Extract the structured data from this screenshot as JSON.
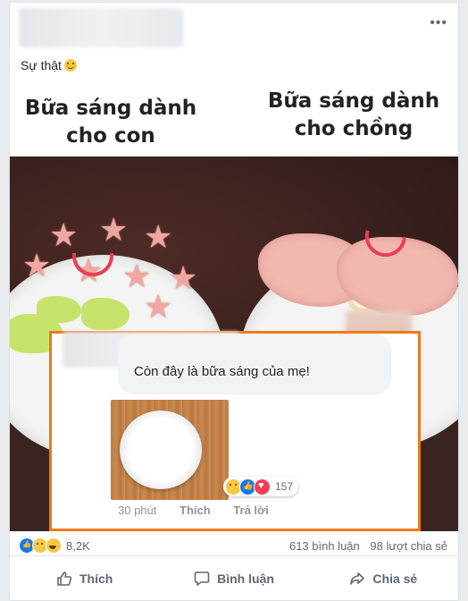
{
  "post": {
    "caption": "Sự thật",
    "more_label": "•••",
    "image": {
      "title_left": "Bữa sáng dành cho con",
      "title_right": "Bữa sáng dành cho chồng"
    },
    "comment": {
      "text": "Còn đây là bữa sáng của mẹ!",
      "reaction_count": "157",
      "time": "30 phút",
      "like_label": "Thích",
      "reply_label": "Trả lời"
    },
    "stats": {
      "reaction_count": "8,2K",
      "comments": "613 bình luận",
      "shares": "98 lượt chia sẻ"
    },
    "actions": {
      "like": "Thích",
      "comment": "Bình luận",
      "share": "Chia sẻ"
    },
    "colors": {
      "highlight_border": "#ee7a16",
      "like_blue": "#1877f2",
      "love_red": "#f33e58"
    }
  }
}
